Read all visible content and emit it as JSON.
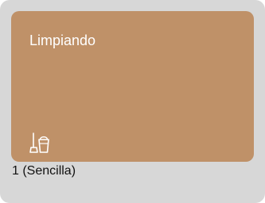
{
  "card": {
    "status_label": "Limpiando",
    "status_icon": "cleaning-bucket-mop-icon",
    "room_label": "1 (Sencilla)",
    "colors": {
      "card_background": "#d7d7d7",
      "status_tile": "#bf9168",
      "status_text": "#ffffff",
      "room_text": "#111111"
    }
  }
}
